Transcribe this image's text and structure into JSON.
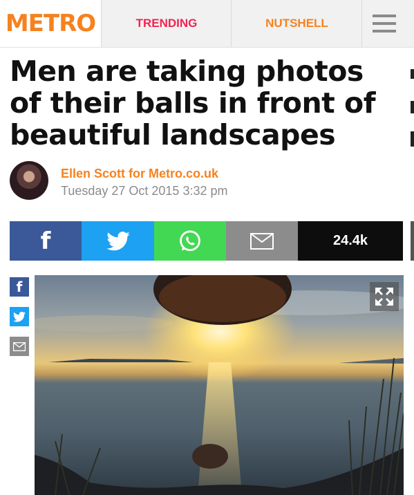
{
  "brand": {
    "logo": "METRO",
    "color": "#f5821f"
  },
  "nav": {
    "trending": "TRENDING",
    "nutshell": "NUTSHELL",
    "menu_icon": "hamburger-menu-icon"
  },
  "article": {
    "headline": "Men are taking photos of their balls in front of beautiful landscapes",
    "author": "Ellen Scott for Metro.co.uk",
    "date": "Tuesday 27 Oct 2015 3:32 pm"
  },
  "share": {
    "count": "24.4k",
    "buttons": [
      {
        "icon": "facebook-icon",
        "color": "#3b5998"
      },
      {
        "icon": "twitter-icon",
        "color": "#1da1f2"
      },
      {
        "icon": "whatsapp-icon",
        "color": "#43d853"
      },
      {
        "icon": "email-icon",
        "color": "#8c8c8c"
      }
    ]
  },
  "side_share": [
    {
      "icon": "facebook-icon"
    },
    {
      "icon": "twitter-icon"
    },
    {
      "icon": "email-icon"
    }
  ],
  "photo": {
    "expand_icon": "expand-icon"
  }
}
